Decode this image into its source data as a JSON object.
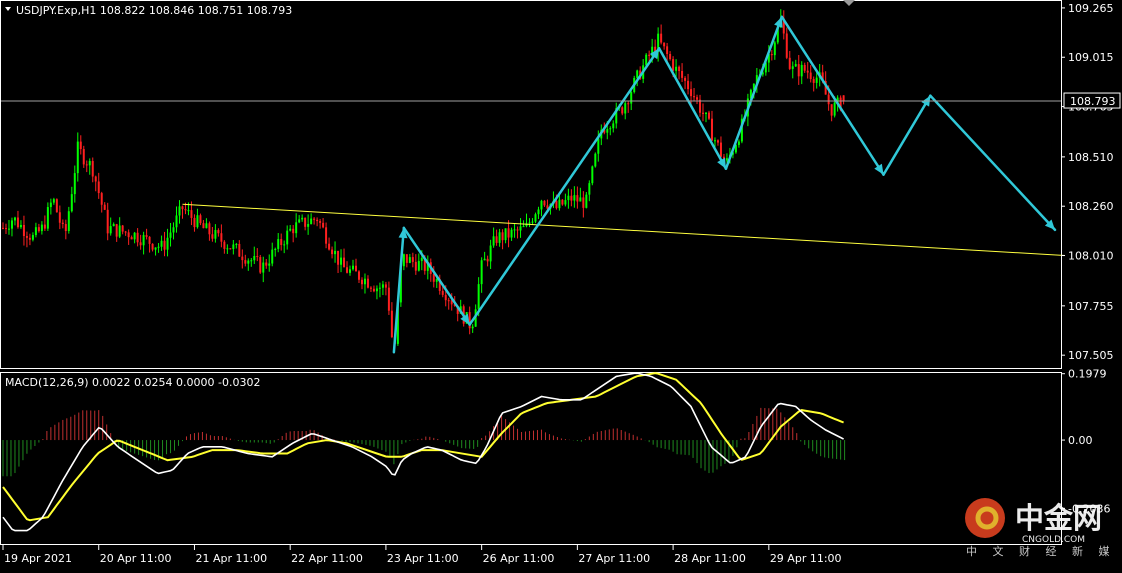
{
  "header": {
    "symbol_line": "USDJPY.Exp,H1  108.822 108.846 108.751 108.793",
    "macd_line": "MACD(12,26,9) 0.0022 0.0254 0.0000 -0.0302"
  },
  "current_price_label": "108.793",
  "watermark": {
    "name": "中金网",
    "domain": "CNGOLD.COM",
    "tagline": "中 文 财 经 新 媒 体"
  },
  "colors": {
    "background": "#000000",
    "bull_candle": "#00ff00",
    "bear_candle": "#ff2020",
    "projection": "#30c8d8",
    "trendline": "#ffff40",
    "macd_line": "#ffffff",
    "signal_line": "#ffff30",
    "hist_pos": "#c03030",
    "hist_neg": "#1f8a1f"
  },
  "chart_data": [
    {
      "type": "candlestick",
      "timeframe": "H1",
      "ylim": [
        107.44,
        109.3
      ],
      "y_ticks": [
        "109.265",
        "109.015",
        "108.765",
        "108.510",
        "108.260",
        "108.010",
        "107.755",
        "107.505"
      ],
      "y_tick_values": [
        109.265,
        109.015,
        108.765,
        108.51,
        108.26,
        108.01,
        107.755,
        107.505
      ],
      "x_ticks": [
        "19 Apr 2021",
        "20 Apr 11:00",
        "21 Apr 11:00",
        "22 Apr 11:00",
        "23 Apr 11:00",
        "26 Apr 11:00",
        "27 Apr 11:00",
        "28 Apr 11:00",
        "29 Apr 11:00"
      ],
      "current_price": 108.793,
      "last_bar": {
        "open": 108.822,
        "high": 108.846,
        "low": 108.751,
        "close": 108.793
      },
      "path_keypoints": [
        [
          0,
          108.15
        ],
        [
          10,
          108.2
        ],
        [
          20,
          108.15
        ],
        [
          30,
          108.1
        ],
        [
          40,
          108.15
        ],
        [
          50,
          108.3
        ],
        [
          62,
          108.1
        ],
        [
          75,
          108.55
        ],
        [
          90,
          108.45
        ],
        [
          105,
          108.15
        ],
        [
          130,
          108.12
        ],
        [
          160,
          108.05
        ],
        [
          180,
          108.25
        ],
        [
          200,
          108.15
        ],
        [
          230,
          108.05
        ],
        [
          260,
          107.95
        ],
        [
          290,
          108.15
        ],
        [
          315,
          108.2
        ],
        [
          340,
          107.95
        ],
        [
          360,
          107.9
        ],
        [
          375,
          107.85
        ],
        [
          385,
          107.85
        ],
        [
          392,
          107.5
        ],
        [
          400,
          108.0
        ],
        [
          410,
          107.98
        ],
        [
          425,
          107.95
        ],
        [
          440,
          107.85
        ],
        [
          455,
          107.75
        ],
        [
          470,
          107.65
        ],
        [
          480,
          107.95
        ],
        [
          495,
          108.1
        ],
        [
          510,
          108.12
        ],
        [
          525,
          108.15
        ],
        [
          540,
          108.3
        ],
        [
          555,
          108.25
        ],
        [
          570,
          108.3
        ],
        [
          585,
          108.28
        ],
        [
          600,
          108.65
        ],
        [
          620,
          108.75
        ],
        [
          640,
          108.95
        ],
        [
          657,
          109.1
        ],
        [
          675,
          108.95
        ],
        [
          690,
          108.85
        ],
        [
          705,
          108.7
        ],
        [
          725,
          108.47
        ],
        [
          740,
          108.65
        ],
        [
          755,
          108.9
        ],
        [
          770,
          109.05
        ],
        [
          780,
          109.2
        ],
        [
          790,
          108.95
        ],
        [
          805,
          108.95
        ],
        [
          820,
          108.9
        ],
        [
          830,
          108.75
        ],
        [
          845,
          108.8
        ]
      ],
      "trendline": {
        "from": [
          180,
          108.27
        ],
        "to": [
          1065,
          108.01
        ]
      },
      "projection_arrows": [
        {
          "from": [
            392,
            107.52
          ],
          "to": [
            402,
            108.15
          ]
        },
        {
          "from": [
            402,
            108.15
          ],
          "to": [
            468,
            107.66
          ]
        },
        {
          "from": [
            468,
            107.66
          ],
          "to": [
            658,
            109.06
          ]
        },
        {
          "from": [
            658,
            109.06
          ],
          "to": [
            725,
            108.45
          ]
        },
        {
          "from": [
            725,
            108.45
          ],
          "to": [
            781,
            109.22
          ]
        },
        {
          "from": [
            781,
            109.22
          ],
          "to": [
            883,
            108.42
          ]
        },
        {
          "from": [
            883,
            108.42
          ],
          "to": [
            930,
            108.82
          ]
        },
        {
          "from": [
            930,
            108.82
          ],
          "to": [
            1055,
            108.14
          ]
        }
      ]
    },
    {
      "type": "macd",
      "name": "MACD(12,26,9)",
      "values": {
        "macd": 0.0022,
        "signal": 0.0254,
        "hist": 0.0,
        "diff": -0.0302
      },
      "ylim": [
        -0.31,
        0.2
      ],
      "y_ticks": [
        "0.1979",
        "0.00",
        "-0.2036"
      ],
      "y_tick_values": [
        0.1979,
        0.0,
        -0.2036
      ],
      "macd_keypoints": [
        [
          0,
          -0.23
        ],
        [
          10,
          -0.27
        ],
        [
          25,
          -0.27
        ],
        [
          40,
          -0.23
        ],
        [
          60,
          -0.12
        ],
        [
          80,
          -0.02
        ],
        [
          97,
          0.04
        ],
        [
          115,
          -0.02
        ],
        [
          135,
          -0.06
        ],
        [
          155,
          -0.1
        ],
        [
          170,
          -0.09
        ],
        [
          185,
          -0.04
        ],
        [
          200,
          -0.02
        ],
        [
          220,
          -0.02
        ],
        [
          245,
          -0.04
        ],
        [
          270,
          -0.05
        ],
        [
          290,
          -0.01
        ],
        [
          310,
          0.02
        ],
        [
          330,
          0.0
        ],
        [
          350,
          -0.02
        ],
        [
          370,
          -0.05
        ],
        [
          385,
          -0.08
        ],
        [
          392,
          -0.11
        ],
        [
          400,
          -0.06
        ],
        [
          410,
          -0.04
        ],
        [
          425,
          -0.02
        ],
        [
          440,
          -0.03
        ],
        [
          460,
          -0.06
        ],
        [
          475,
          -0.07
        ],
        [
          485,
          -0.02
        ],
        [
          500,
          0.08
        ],
        [
          520,
          0.1
        ],
        [
          540,
          0.13
        ],
        [
          560,
          0.12
        ],
        [
          580,
          0.12
        ],
        [
          600,
          0.16
        ],
        [
          615,
          0.19
        ],
        [
          635,
          0.2
        ],
        [
          650,
          0.19
        ],
        [
          670,
          0.16
        ],
        [
          690,
          0.1
        ],
        [
          710,
          -0.02
        ],
        [
          730,
          -0.07
        ],
        [
          745,
          -0.05
        ],
        [
          760,
          0.04
        ],
        [
          778,
          0.11
        ],
        [
          795,
          0.1
        ],
        [
          810,
          0.06
        ],
        [
          825,
          0.03
        ],
        [
          845,
          0.0
        ]
      ],
      "signal_keypoints": [
        [
          0,
          -0.14
        ],
        [
          25,
          -0.24
        ],
        [
          45,
          -0.23
        ],
        [
          70,
          -0.13
        ],
        [
          95,
          -0.04
        ],
        [
          115,
          0.0
        ],
        [
          140,
          -0.03
        ],
        [
          165,
          -0.06
        ],
        [
          190,
          -0.05
        ],
        [
          210,
          -0.03
        ],
        [
          235,
          -0.03
        ],
        [
          260,
          -0.04
        ],
        [
          285,
          -0.04
        ],
        [
          305,
          -0.01
        ],
        [
          325,
          0.0
        ],
        [
          345,
          -0.01
        ],
        [
          365,
          -0.03
        ],
        [
          385,
          -0.05
        ],
        [
          400,
          -0.05
        ],
        [
          420,
          -0.03
        ],
        [
          440,
          -0.03
        ],
        [
          460,
          -0.04
        ],
        [
          480,
          -0.05
        ],
        [
          500,
          0.02
        ],
        [
          520,
          0.08
        ],
        [
          545,
          0.11
        ],
        [
          570,
          0.12
        ],
        [
          595,
          0.13
        ],
        [
          615,
          0.16
        ],
        [
          635,
          0.19
        ],
        [
          655,
          0.2
        ],
        [
          675,
          0.18
        ],
        [
          700,
          0.11
        ],
        [
          720,
          0.02
        ],
        [
          740,
          -0.06
        ],
        [
          760,
          -0.04
        ],
        [
          780,
          0.04
        ],
        [
          800,
          0.09
        ],
        [
          820,
          0.08
        ],
        [
          845,
          0.05
        ]
      ]
    }
  ]
}
